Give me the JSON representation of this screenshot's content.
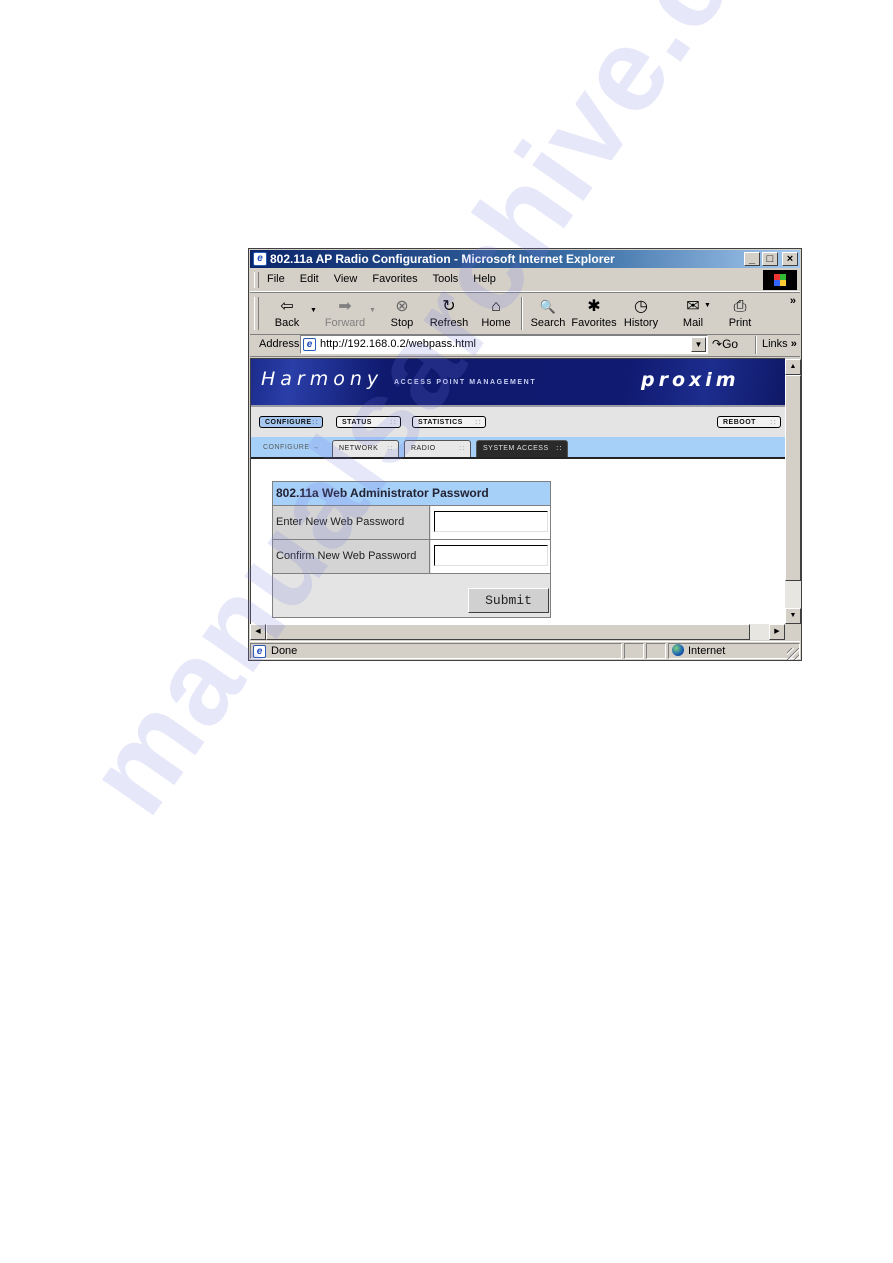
{
  "window": {
    "title": "802.11a AP Radio Configuration - Microsoft Internet Explorer",
    "controls": {
      "minimize": "_",
      "maximize": "□",
      "close": "×"
    }
  },
  "menu": [
    "File",
    "Edit",
    "View",
    "Favorites",
    "Tools",
    "Help"
  ],
  "toolbar": {
    "buttons": [
      {
        "label": "Back",
        "icon": "back-arrow-icon",
        "glyph": "⇦",
        "enabled": true,
        "dropdown": true
      },
      {
        "label": "Forward",
        "icon": "forward-arrow-icon",
        "glyph": "➡",
        "enabled": false,
        "dropdown": true
      },
      {
        "label": "Stop",
        "icon": "stop-icon",
        "glyph": "⊗",
        "enabled": true
      },
      {
        "label": "Refresh",
        "icon": "refresh-icon",
        "glyph": "↻",
        "enabled": true
      },
      {
        "label": "Home",
        "icon": "home-icon",
        "glyph": "⌂",
        "enabled": true
      },
      {
        "label": "Search",
        "icon": "search-icon",
        "glyph": "🔍",
        "enabled": true
      },
      {
        "label": "Favorites",
        "icon": "favorites-icon",
        "glyph": "✱",
        "enabled": true
      },
      {
        "label": "History",
        "icon": "history-icon",
        "glyph": "◷",
        "enabled": true
      },
      {
        "label": "Mail",
        "icon": "mail-icon",
        "glyph": "✉",
        "enabled": true,
        "dropdown": true
      },
      {
        "label": "Print",
        "icon": "print-icon",
        "glyph": "⎙",
        "enabled": true
      }
    ],
    "overflow": "»"
  },
  "address": {
    "label": "Address",
    "url": "http://192.168.0.2/webpass.html",
    "go_label": "Go",
    "links_label": "Links",
    "links_overflow": "»"
  },
  "page": {
    "brand": "Harmony",
    "brand_subtitle": "ACCESS POINT MANAGEMENT",
    "vendor_logo": "proxim",
    "main_nav": [
      {
        "label": "CONFIGURE",
        "active": true
      },
      {
        "label": "STATUS",
        "active": false
      },
      {
        "label": "STATISTICS",
        "active": false
      },
      {
        "label": "REBOOT",
        "active": false
      }
    ],
    "breadcrumb": "CONFIGURE →",
    "sub_nav": [
      {
        "label": "NETWORK",
        "active": false
      },
      {
        "label": "RADIO",
        "active": false
      },
      {
        "label": "SYSTEM ACCESS",
        "active": true
      }
    ],
    "form": {
      "title": "802.11a Web Administrator Password",
      "fields": [
        {
          "label": "Enter New Web Password",
          "value": ""
        },
        {
          "label": "Confirm New Web Password",
          "value": ""
        }
      ],
      "submit_label": "Submit"
    }
  },
  "status": {
    "text": "Done",
    "zone": "Internet"
  },
  "colors": {
    "titlebar": "#0a246a",
    "banner": "#101a70",
    "nav_active": "#a6c8f0",
    "subnav_bar": "#a6d0f8",
    "form_header": "#a6d0f8"
  },
  "watermark": "manualsarchive.com"
}
